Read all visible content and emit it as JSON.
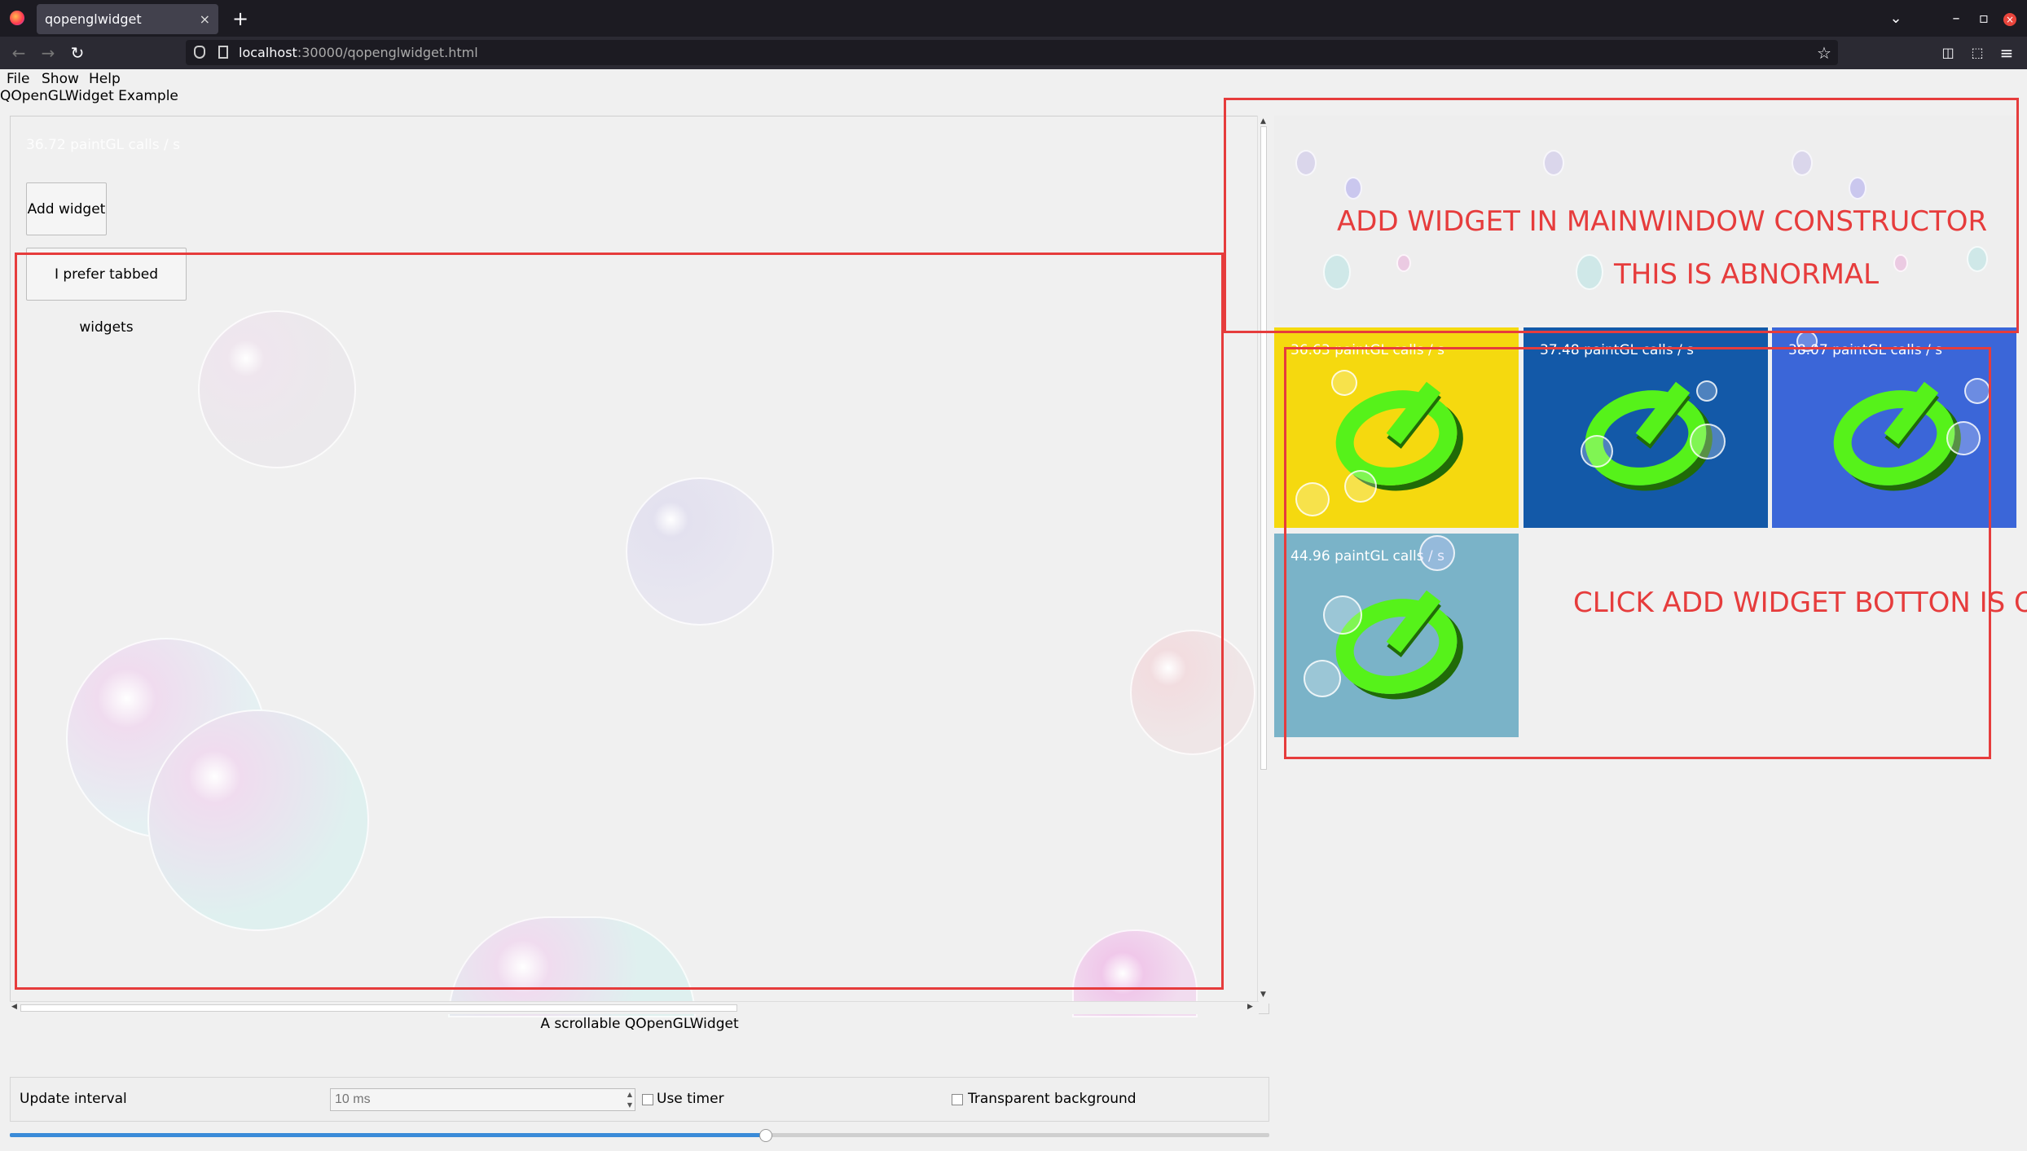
{
  "browser": {
    "tab_title": "qopenglwidget",
    "tab_close": "×",
    "new_tab": "+",
    "url_host": "localhost",
    "url_path": ":30000/qopenglwidget.html"
  },
  "menu": {
    "file": "File",
    "show": "Show",
    "help": "Help"
  },
  "app": {
    "title": "QOpenGLWidget Example",
    "fps_main": "36.72 paintGL calls / s",
    "add_widget": "Add widget",
    "tabbed": "I prefer tabbed widgets",
    "caption": "A scrollable QOpenGLWidget"
  },
  "controls": {
    "update_interval": "Update interval",
    "interval_placeholder": "10 ms",
    "use_timer": "Use timer",
    "transparent_bg": "Transparent background",
    "slider_value": 0.6
  },
  "tiles": [
    {
      "fps": "36.63 paintGL calls / s",
      "color": "#f5d90f"
    },
    {
      "fps": "37.48 paintGL calls / s",
      "color": "#1359a8"
    },
    {
      "fps": "38.07 paintGL calls / s",
      "color": "#3b66d8"
    },
    {
      "fps": "44.96 paintGL calls / s",
      "color": "#7ab3c8"
    }
  ],
  "annotations": {
    "top_line1": "ADD WIDGET IN MAINWINDOW CONSTRUCTOR",
    "top_line2": "THIS IS ABNORMAL",
    "bottom": "CLICK ADD WIDGET BOTTON IS OK"
  },
  "colors": {
    "annotation": "#e63c3c",
    "slider": "#3a8bd8"
  }
}
